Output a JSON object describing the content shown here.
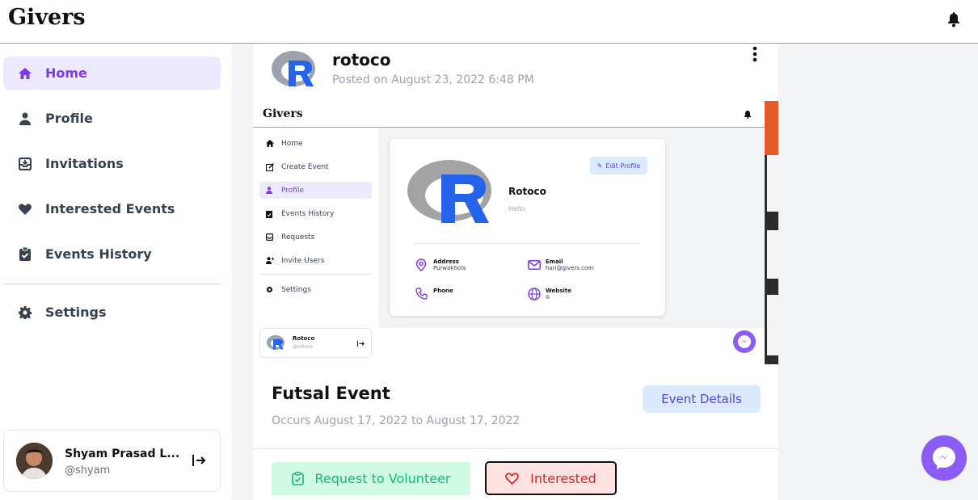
{
  "app": {
    "brand": "Givers"
  },
  "sidebar": {
    "items": [
      {
        "label": "Home",
        "icon": "home-icon",
        "active": true
      },
      {
        "label": "Profile",
        "icon": "user-icon"
      },
      {
        "label": "Invitations",
        "icon": "inbox-icon"
      },
      {
        "label": "Interested Events",
        "icon": "heart-icon"
      },
      {
        "label": "Events History",
        "icon": "clipboard-check-icon"
      },
      {
        "label": "Settings",
        "icon": "gear-icon"
      }
    ],
    "user": {
      "name": "Shyam Prasad L...",
      "handle": "@shyam"
    }
  },
  "post": {
    "author": "rotoco",
    "posted_on": "Posted on August 23, 2022 6:48 PM",
    "screenshot": {
      "brand": "Givers",
      "nav": [
        {
          "label": "Home"
        },
        {
          "label": "Create Event"
        },
        {
          "label": "Profile",
          "active": true
        },
        {
          "label": "Events History"
        },
        {
          "label": "Requests"
        },
        {
          "label": "Invite Users"
        },
        {
          "label": "Settings"
        }
      ],
      "profile": {
        "edit_label": "Edit Profile",
        "name": "Rotoco",
        "bio": "Hello",
        "address_label": "Address",
        "address_value": "Purwakhola",
        "email_label": "Email",
        "email_value": "hari@givers.com",
        "phone_label": "Phone",
        "website_label": "Website"
      },
      "user": {
        "name": "Rotoco",
        "handle": "@rotoco"
      }
    },
    "event": {
      "title": "Futsal Event",
      "occurs": "Occurs August 17, 2022 to August 17, 2022",
      "details_label": "Event Details",
      "volunteer_label": "Request to Volunteer",
      "interested_label": "Interested"
    }
  },
  "colors": {
    "accent": "#7c3aed",
    "active_bg": "#ede9fe",
    "volunteer_bg": "#d1fae5",
    "interested_bg": "#fee2e2"
  }
}
